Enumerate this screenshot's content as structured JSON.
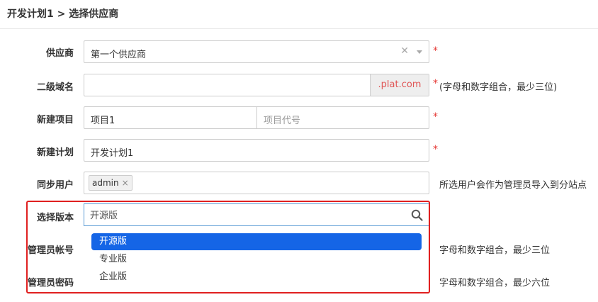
{
  "header": {
    "title": "开发计划1 > 选择供应商"
  },
  "form": {
    "supplier": {
      "label": "供应商",
      "value": "第一个供应商",
      "required": "*"
    },
    "domain": {
      "label": "二级域名",
      "value": "",
      "suffix": ".plat.com",
      "required": "*",
      "hint": "(字母和数字组合，最少三位)"
    },
    "project": {
      "label": "新建项目",
      "name_value": "项目1",
      "code_placeholder": "项目代号",
      "required": "*"
    },
    "plan": {
      "label": "新建计划",
      "value": "开发计划1",
      "required": "*"
    },
    "sync_users": {
      "label": "同步用户",
      "tags": [
        {
          "label": "admin",
          "remove": "×"
        }
      ],
      "hint": "所选用户会作为管理员导入到分站点"
    },
    "version": {
      "label": "选择版本",
      "search_placeholder": "开源版"
    },
    "admin_account": {
      "label": "管理员帐号",
      "hint": "字母和数字组合，最少三位"
    },
    "admin_password": {
      "label": "管理员密码",
      "hint": "字母和数字组合，最少六位"
    }
  },
  "version_options": [
    {
      "label": "开源版",
      "selected": true
    },
    {
      "label": "专业版",
      "selected": false
    },
    {
      "label": "企业版",
      "selected": false
    }
  ],
  "colors": {
    "required": "#e53935",
    "highlight_box": "#e02020",
    "selected_option": "#1565e6",
    "domain_suffix": "#e05555"
  }
}
